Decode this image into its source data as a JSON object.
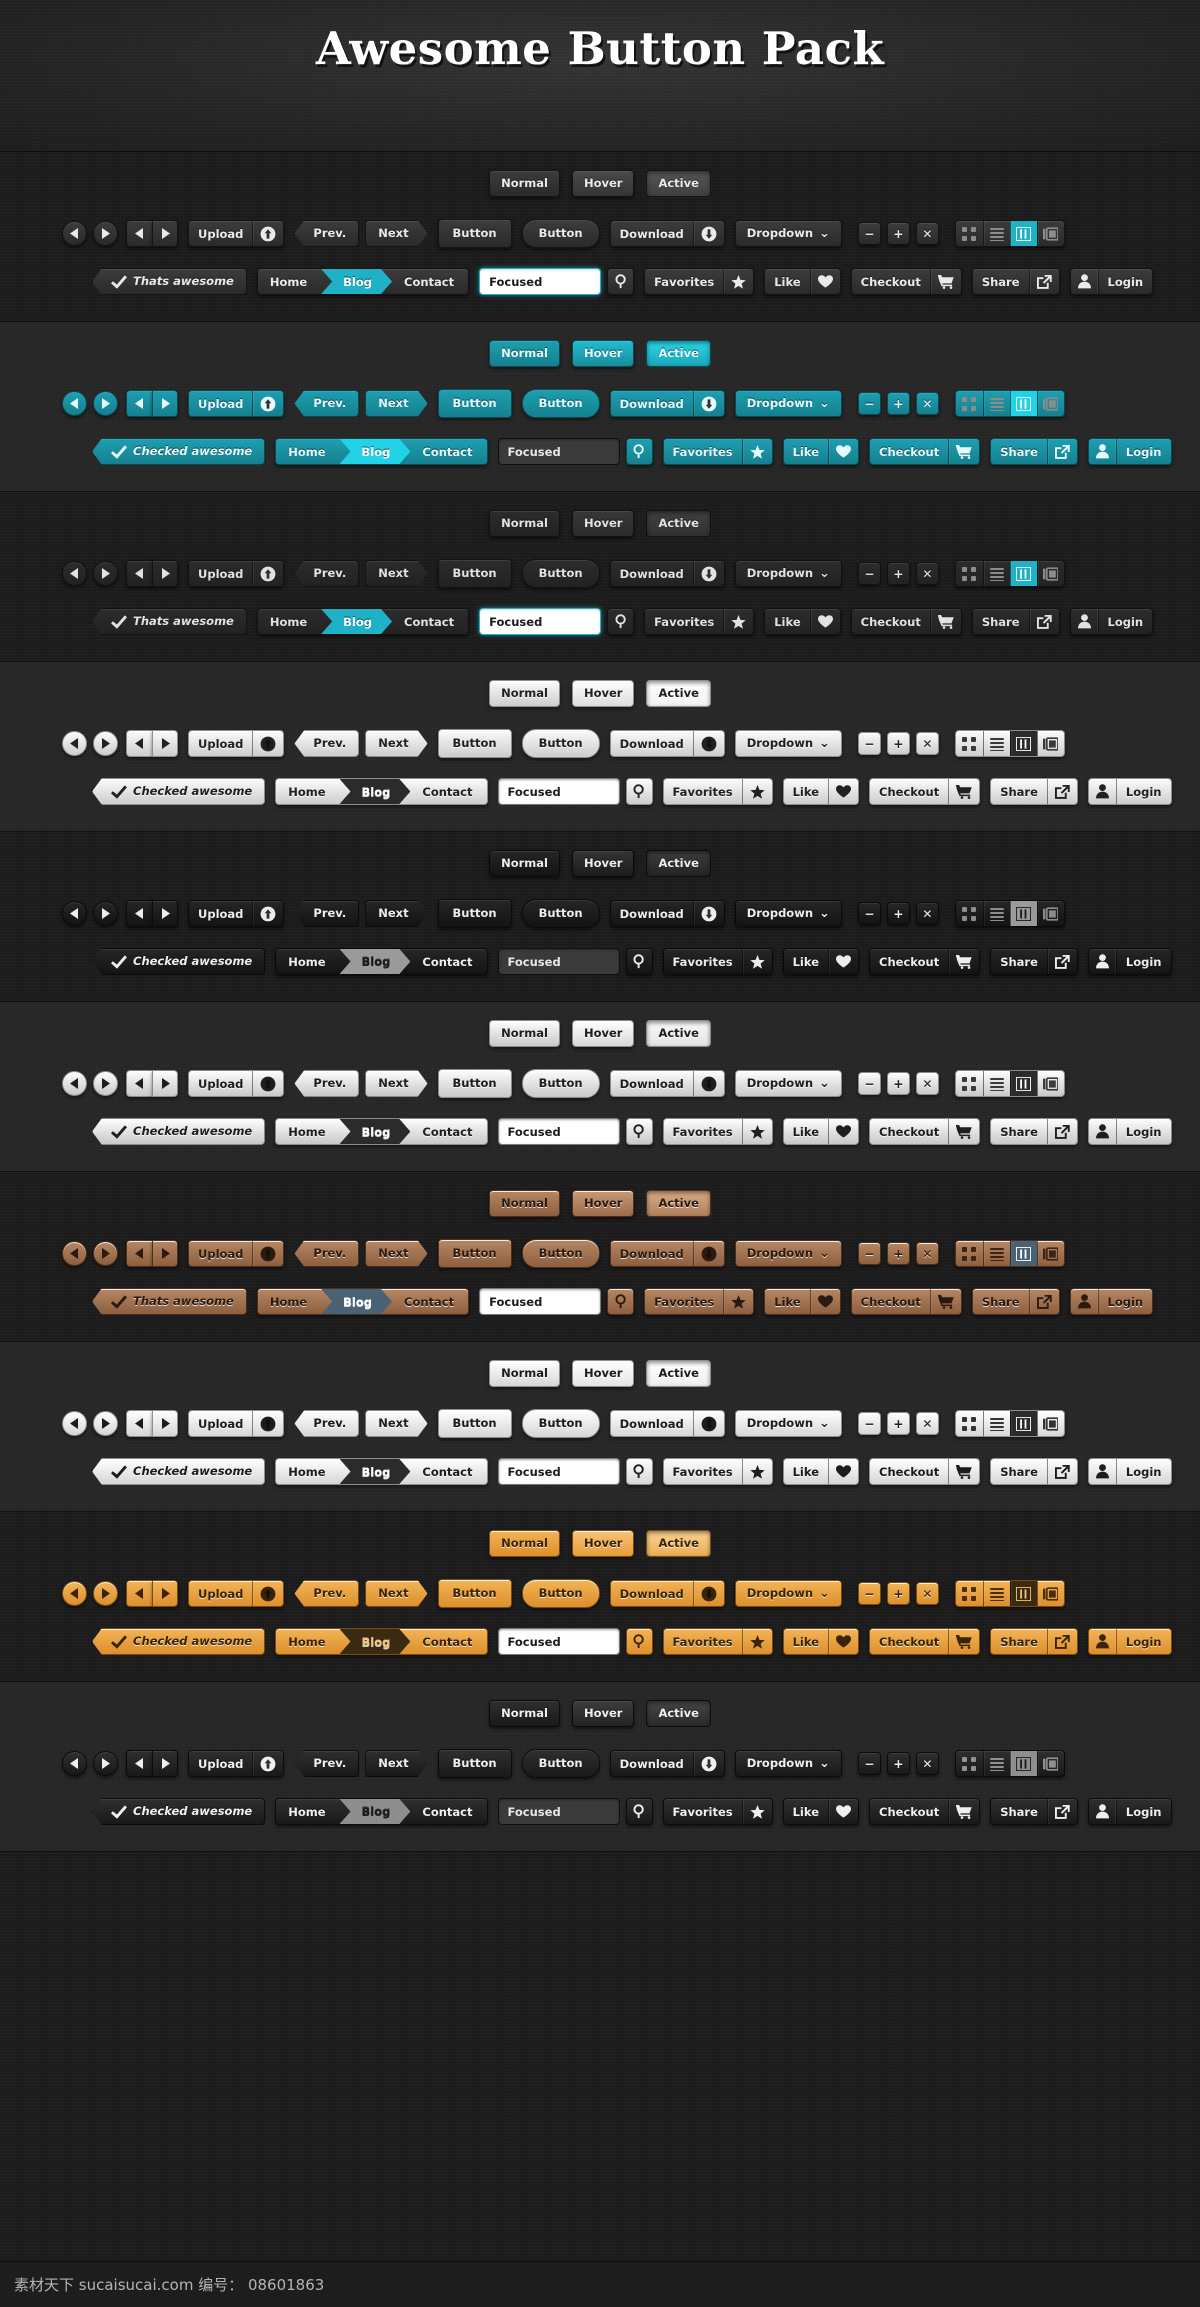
{
  "header": {
    "title": "Awesome Button Pack"
  },
  "labels": {
    "normal": "Normal",
    "hover": "Hover",
    "active": "Active",
    "upload": "Upload",
    "prev": "Prev.",
    "next": "Next",
    "button": "Button",
    "download": "Download",
    "dropdown": "Dropdown",
    "dropdown_caret": "⌄",
    "minus": "−",
    "plus": "+",
    "close": "✕",
    "home": "Home",
    "blog": "Blog",
    "contact": "Contact",
    "focused": "Focused",
    "favorites": "Favorites",
    "like": "Like",
    "checkout": "Checkout",
    "share": "Share",
    "login": "Login",
    "check_thats": "Thats awesome",
    "check_checked": "Checked awesome"
  },
  "icons": {
    "arrow_left": "arrow-left-icon",
    "arrow_right": "arrow-right-icon",
    "upload": "upload-circle-icon",
    "download": "download-circle-icon",
    "search": "search-icon",
    "star": "star-icon",
    "heart": "heart-icon",
    "cart": "shopping-cart-icon",
    "external": "external-link-icon",
    "user": "user-icon",
    "check": "check-icon",
    "grid": "grid-view-icon",
    "list": "list-view-icon",
    "columns": "columns-view-icon",
    "panel": "panel-view-icon"
  },
  "sections": [
    {
      "name": "charcoal-gloss",
      "band": "dark-a",
      "checkLabel": "Thats awesome",
      "inputStyle": "light",
      "accent": "#1fb2c6",
      "colors": {
        "bg1": "#3c3c3c",
        "bg2": "#2a2a2a",
        "bd": "#141414",
        "fg": "#eaeaea",
        "bgh1": "#4a4a4a",
        "bgh2": "#353535",
        "bga1": "#555555",
        "bga2": "#404040",
        "seg": "#333333",
        "segfg": "#8c8c8c",
        "accfg": "#ffffff"
      }
    },
    {
      "name": "teal",
      "band": "dark-b",
      "checkLabel": "Checked awesome",
      "inputStyle": "dark",
      "accent": "#22d3e8",
      "colors": {
        "bg1": "#1d9fb0",
        "bg2": "#15808f",
        "bd": "#0b4a53",
        "fg": "#e6fbff",
        "bgh1": "#22bdd0",
        "bgh2": "#178d9d",
        "bga1": "#2ad6e8",
        "bga2": "#1aa7b8",
        "seg": "#333333",
        "segfg": "#8c8c8c",
        "accfg": "#ffffff"
      }
    },
    {
      "name": "flat-dark",
      "band": "dark-a",
      "checkLabel": "Thats awesome",
      "inputStyle": "light",
      "accent": "#1fb2c6",
      "colors": {
        "bg1": "#2c2c2c",
        "bg2": "#222222",
        "bd": "#121212",
        "fg": "#e2e2e2",
        "bgh1": "#383838",
        "bgh2": "#2b2b2b",
        "bga1": "#414141",
        "bga2": "#313131",
        "seg": "#2b2b2b",
        "segfg": "#8c8c8c",
        "accfg": "#ffffff"
      }
    },
    {
      "name": "silver",
      "band": "dark-b",
      "checkLabel": "Checked awesome",
      "inputStyle": "plain",
      "accent": "#2b2b2b",
      "colors": {
        "bg1": "#fbfbfb",
        "bg2": "#cdcdcd",
        "bd": "#8e8e8e",
        "fg": "#212121",
        "bgh1": "#ffffff",
        "bgh2": "#dcdcdc",
        "bga1": "#ffffff",
        "bga2": "#f2f2f2",
        "seg": "#e6e6e6",
        "segfg": "#3a3a3a",
        "accfg": "#ffffff"
      }
    },
    {
      "name": "near-black",
      "band": "dark-a",
      "checkLabel": "Checked awesome",
      "inputStyle": "dark",
      "accent": "#9a9a9a",
      "colors": {
        "bg1": "#262626",
        "bg2": "#131313",
        "bd": "#0a0a0a",
        "fg": "#ededed",
        "bgh1": "#343434",
        "bgh2": "#1c1c1c",
        "bga1": "#3d3d3d",
        "bga2": "#232323",
        "seg": "#1a1a1a",
        "segfg": "#8c8c8c",
        "accfg": "#1a1a1a"
      }
    },
    {
      "name": "light-silver",
      "band": "dark-b",
      "checkLabel": "Checked awesome",
      "inputStyle": "plain",
      "accent": "#2b2b2b",
      "colors": {
        "bg1": "#fdfdfd",
        "bg2": "#c8c8c8",
        "bd": "#8a8a8a",
        "fg": "#1e1e1e",
        "bgh1": "#ffffff",
        "bgh2": "#d8d8d8",
        "bga1": "#fafafa",
        "bga2": "#e3e3e3",
        "seg": "#e2e2e2",
        "segfg": "#3a3a3a",
        "accfg": "#ffffff"
      }
    },
    {
      "name": "wood-brown",
      "band": "dark-a",
      "checkLabel": "Thats awesome",
      "inputStyle": "plain",
      "accent": "#4a6275",
      "colors": {
        "bg1": "#b58763",
        "bg2": "#8e5f3f",
        "bd": "#4d2f1b",
        "fg": "#2a1a0f",
        "bgh1": "#c79a76",
        "bgh2": "#9c6c4a",
        "bga1": "#d7ad88",
        "bga2": "#b0805b",
        "seg": "#a87a57",
        "segfg": "#3a2415",
        "accfg": "#ffffff"
      }
    },
    {
      "name": "bright-white",
      "band": "dark-b",
      "checkLabel": "Checked awesome",
      "inputStyle": "plain",
      "accent": "#2b2b2b",
      "colors": {
        "bg1": "#ffffff",
        "bg2": "#d6d6d6",
        "bd": "#8f8f8f",
        "fg": "#1c1c1c",
        "bgh1": "#ffffff",
        "bgh2": "#e4e4e4",
        "bga1": "#ffffff",
        "bga2": "#efefef",
        "seg": "#ededed",
        "segfg": "#333333",
        "accfg": "#ffffff"
      }
    },
    {
      "name": "amber-orange",
      "band": "dark-a",
      "checkLabel": "Checked awesome",
      "inputStyle": "plain",
      "accent": "#3a2a12",
      "colors": {
        "bg1": "#f2b457",
        "bg2": "#dd8f2c",
        "bd": "#7a4a10",
        "fg": "#3a2408",
        "bgh1": "#f8c478",
        "bgh2": "#e79c3b",
        "bga1": "#fbd392",
        "bga2": "#eaae55",
        "seg": "#e9a542",
        "segfg": "#4a2e0c",
        "accfg": "#f0c27a"
      }
    },
    {
      "name": "graphite",
      "band": "dark-b",
      "checkLabel": "Checked awesome",
      "inputStyle": "dark",
      "accent": "#8e8e8e",
      "colors": {
        "bg1": "#2f2f2f",
        "bg2": "#191919",
        "bd": "#0b0b0b",
        "fg": "#f0f0f0",
        "bgh1": "#3d3d3d",
        "bgh2": "#232323",
        "bga1": "#464646",
        "bga2": "#2b2b2b",
        "seg": "#212121",
        "segfg": "#919191",
        "accfg": "#1a1a1a"
      }
    }
  ],
  "footer": {
    "text": "素材天下 sucaisucai.com  编号： 08601863"
  }
}
